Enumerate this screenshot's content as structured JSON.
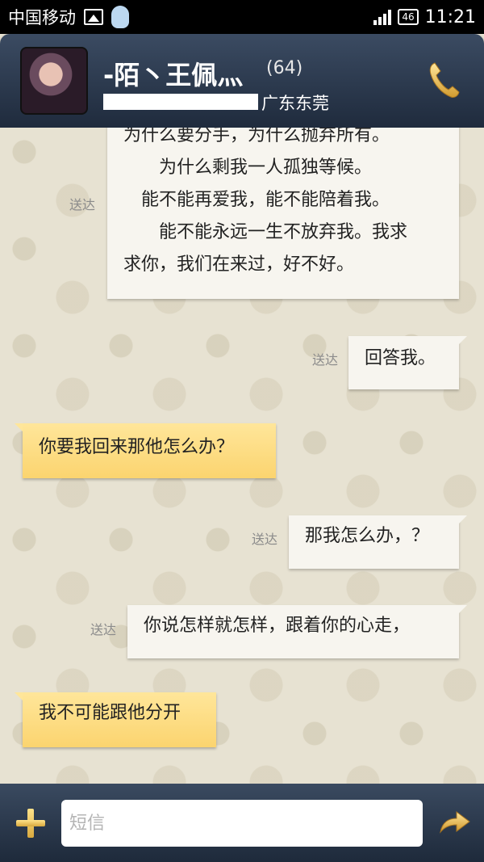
{
  "status_bar": {
    "carrier": "中国移动",
    "network_badge": "46",
    "time": "11:21",
    "icons": [
      "image-icon",
      "qq-penguin-icon",
      "signal-icon"
    ]
  },
  "header": {
    "contact_name": "-陌丶王佩灬",
    "message_count": "(64)",
    "location": "广东东莞",
    "icons": [
      "avatar",
      "phone-icon"
    ]
  },
  "messages": [
    {
      "direction": "outgoing",
      "status": "送达",
      "lines": [
        "为什么要分手，为什么抛弃所有。",
        "　　为什么剩我一人孤独等候。",
        "　能不能再爱我，能不能陪着我。",
        "　　能不能永远一生不放弃我。我求",
        "求你，我们在来过，好不好。"
      ]
    },
    {
      "direction": "outgoing",
      "status": "送达",
      "lines": [
        "回答我。"
      ]
    },
    {
      "direction": "incoming",
      "lines": [
        "你要我回来那他怎么办？"
      ]
    },
    {
      "direction": "outgoing",
      "status": "送达",
      "lines": [
        "那我怎么办，？"
      ]
    },
    {
      "direction": "outgoing",
      "status": "送达",
      "lines": [
        "你说怎样就怎样，跟着你的心走，"
      ]
    },
    {
      "direction": "incoming",
      "lines": [
        "我不可能跟他分开"
      ]
    }
  ],
  "input_bar": {
    "placeholder": "短信",
    "icons": [
      "plus-icon",
      "send-arrow-icon"
    ]
  },
  "colors": {
    "header_bg": "#2c3a4f",
    "outgoing_bubble": "#f7f5ef",
    "incoming_bubble": "#fbd46f",
    "chat_bg": "#e7e2d2"
  }
}
